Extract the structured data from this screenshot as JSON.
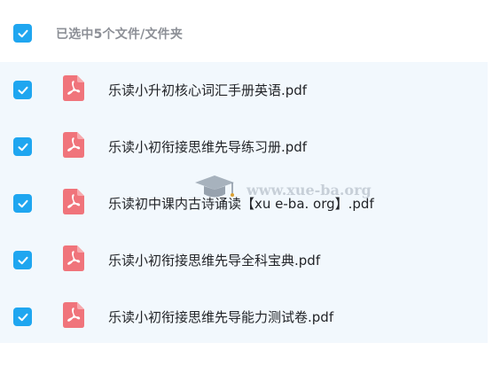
{
  "header": {
    "select_all_checked": true,
    "selection_summary": "已选中5个文件/文件夹"
  },
  "files": [
    {
      "name": "乐读小升初核心词汇手册英语.pdf",
      "checked": true,
      "icon": "pdf-icon"
    },
    {
      "name": "乐读小初衔接思维先导练习册.pdf",
      "checked": true,
      "icon": "pdf-icon"
    },
    {
      "name": "乐读初中课内古诗诵读【xu e-ba. org】.pdf",
      "checked": true,
      "icon": "pdf-icon"
    },
    {
      "name": "乐读小初衔接思维先导全科宝典.pdf",
      "checked": true,
      "icon": "pdf-icon"
    },
    {
      "name": "乐读小初衔接思维先导能力测试卷.pdf",
      "checked": true,
      "icon": "pdf-icon"
    }
  ],
  "watermark": {
    "text": "www.xue-ba.org",
    "icon": "graduation-cap-icon"
  },
  "colors": {
    "checkbox": "#1fa6f0",
    "pdf_icon": "#f0747b",
    "list_background": "#f2f8fd",
    "header_text": "#8c8f96",
    "file_text": "#222428"
  }
}
